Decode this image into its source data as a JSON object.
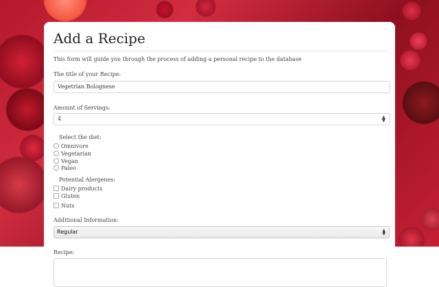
{
  "page": {
    "title": "Add a Recipe",
    "intro": "This form will guide you through the process of adding a personal recipe to the database"
  },
  "recipe_title": {
    "label": "The title of your Recipe:",
    "value": "Vegetrian Bolognese"
  },
  "servings": {
    "label": "Amount of Servings:",
    "value": "4",
    "icon": "stepper-arrows-icon"
  },
  "diet": {
    "label": "Select the diet:",
    "options": [
      "Omnivore",
      "Vegetarian",
      "Vegan",
      "Paleo"
    ]
  },
  "allergens": {
    "label": "Potential Alergenes:",
    "options": [
      "Dairy products",
      "Gluten",
      "Nuts"
    ]
  },
  "additional_info": {
    "label": "Additional Information:",
    "selected": "Regular",
    "icon": "select-arrows-icon"
  },
  "recipe": {
    "label": "Recipe:"
  }
}
